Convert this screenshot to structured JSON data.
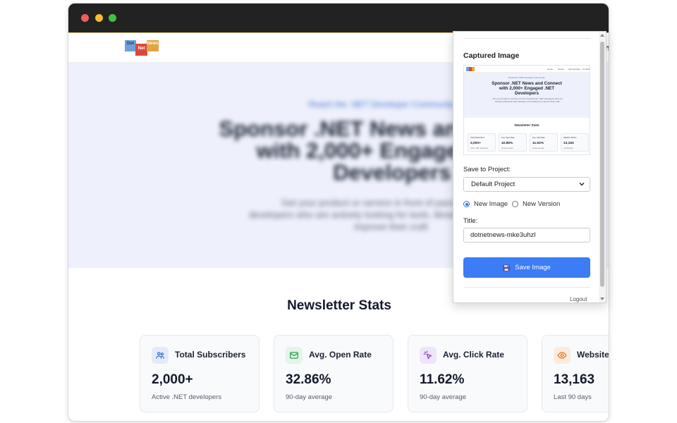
{
  "site": {
    "logo": {
      "dot": "Dot",
      "net": "Net",
      "news": "News"
    },
    "nav_partial": "h",
    "hero": {
      "kicker": "Reach the .NET Developer Community",
      "title_line1": "Sponsor .NET News and Connect",
      "title_line2": "with 2,000+ Engaged .NET",
      "title_line3": "Developers",
      "subtitle_line1": "Get your product or service in front of passionate .NET",
      "subtitle_line2": "developers who are actively looking for tools, libraries, and solutions to",
      "subtitle_line3": "improve their craft."
    },
    "stats_title": "Newsletter Stats",
    "cards": [
      {
        "icon": "users-icon",
        "label": "Total Subscribers",
        "value": "2,000+",
        "note": "Active .NET developers",
        "icon_color": "#3d6fd6",
        "icon_bg": "#e3ebfb"
      },
      {
        "icon": "mail-icon",
        "label": "Avg. Open Rate",
        "value": "32.86%",
        "note": "90-day average",
        "icon_color": "#2f9e55",
        "icon_bg": "#e2f5e7"
      },
      {
        "icon": "cursor-click-icon",
        "label": "Avg. Click Rate",
        "value": "11.62%",
        "note": "90-day average",
        "icon_color": "#8e44d8",
        "icon_bg": "#efe5fb"
      },
      {
        "icon": "eye-icon",
        "label": "Website",
        "value": "13,163",
        "note": "Last 90 days",
        "icon_color": "#d9792b",
        "icon_bg": "#fcebdc"
      }
    ]
  },
  "popup": {
    "heading": "Captured Image",
    "thumbnail": {
      "nav": [
        "Home",
        "Issues",
        "Sponsorship",
        "Contact"
      ],
      "kicker": "Reach the .NET Developer Community",
      "title_line1": "Sponsor .NET News and Connect",
      "title_line2": "with 2,000+ Engaged .NET",
      "title_line3": "Developers",
      "subtitle": "Get your product or service in front of passionate .NET developers who are actively looking for tools, libraries, and solutions to improve their craft.",
      "stats_title": "Newsletter Stats",
      "cards": [
        {
          "label": "Total Subscribers",
          "value": "2,000+",
          "note": "Active .NET developers"
        },
        {
          "label": "Avg. Open Rate",
          "value": "32.86%",
          "note": "90-day average"
        },
        {
          "label": "Avg. Click Rate",
          "value": "11.62%",
          "note": "90-day average"
        },
        {
          "label": "Website Visitors",
          "value": "13,163",
          "note": "Last 90 days"
        }
      ]
    },
    "save_to_label": "Save to Project:",
    "project_selected": "Default Project",
    "radio_new_image": "New Image",
    "radio_new_version": "New Version",
    "title_label": "Title:",
    "title_value": "dotnetnews-mke3uhzl",
    "save_button": "Save Image",
    "logout": "Logout"
  }
}
